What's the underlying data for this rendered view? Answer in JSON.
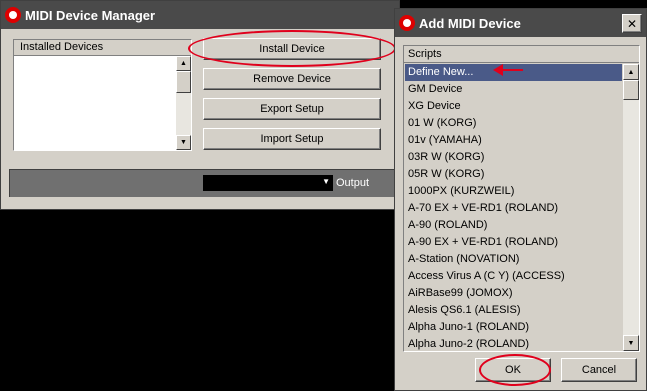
{
  "manager": {
    "title": "MIDI Device Manager",
    "installed_label": "Installed Devices",
    "buttons": {
      "install": "Install Device",
      "remove": "Remove Device",
      "export": "Export Setup",
      "import": "Import Setup"
    },
    "output_label": "Output"
  },
  "dialog": {
    "title": "Add MIDI Device",
    "close_glyph": "✕",
    "scripts_label": "Scripts",
    "items": [
      "Define New...",
      "GM Device",
      "XG Device",
      "01 W (KORG)",
      "01v (YAMAHA)",
      "03R W (KORG)",
      "05R W (KORG)",
      "1000PX (KURZWEIL)",
      "A-70 EX + VE-RD1 (ROLAND)",
      "A-90 (ROLAND)",
      "A-90 EX + VE-RD1 (ROLAND)",
      "A-Station (NOVATION)",
      "Access Virus A (C Y) (ACCESS)",
      "AiRBase99 (JOMOX)",
      "Alesis QS6.1 (ALESIS)",
      "Alpha Juno-1 (ROLAND)",
      "Alpha Juno-2 (ROLAND)"
    ],
    "selected_index": 0,
    "ok_label": "OK",
    "cancel_label": "Cancel"
  }
}
